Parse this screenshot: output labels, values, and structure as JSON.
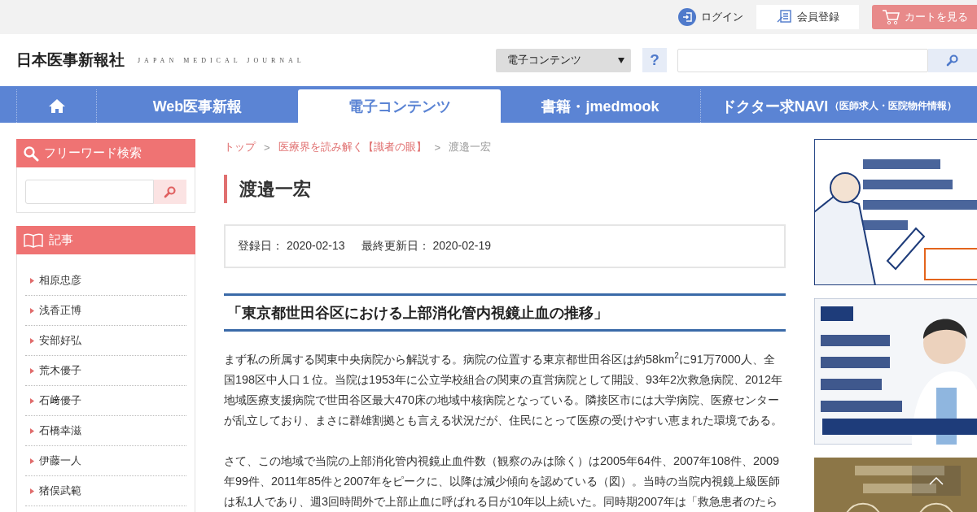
{
  "top_bar": {
    "login": "ログイン",
    "register": "会員登録",
    "cart": "カートを見る"
  },
  "header": {
    "logo": "日本医事新報社",
    "logo_sub": "JAPAN MEDICAL JOURNAL",
    "category_select": "電子コンテンツ",
    "help": "?"
  },
  "nav": [
    {
      "kind": "home",
      "selected": false
    },
    {
      "kind": "text",
      "label": "Web医事新報",
      "selected": false
    },
    {
      "kind": "text",
      "label": "電子コンテンツ",
      "selected": true
    },
    {
      "kind": "text",
      "label": "書籍・jmedmook",
      "selected": false
    },
    {
      "kind": "text",
      "label": "ドクター求NAVI",
      "note": "（医師求人・医院物件情報）",
      "selected": false
    }
  ],
  "sidebar": {
    "search_title": "フリーワード検索",
    "articles_title": "記事",
    "articles": [
      "相原忠彦",
      "浅香正博",
      "安部好弘",
      "荒木優子",
      "石﨑優子",
      "石橋幸滋",
      "伊藤一人",
      "猪俣武範"
    ]
  },
  "breadcrumb": [
    {
      "label": "トップ",
      "link": true
    },
    {
      "separator": ">",
      "label": "医療界を読み解く【識者の眼】",
      "link": true
    },
    {
      "separator": ">",
      "label": "渡邉一宏",
      "link": false
    }
  ],
  "article": {
    "title": "渡邉一宏",
    "registered_label": "登録日：",
    "registered": "2020-02-13",
    "updated_label": "最終更新日：",
    "updated": "2020-02-19",
    "heading": "「東京都世田谷区における上部消化管内視鏡止血の推移」",
    "paragraphs": [
      "まず私の所属する関東中央病院から解説する。病院の位置する東京都世田谷区は約58km$^{2}$に91万7000人、全国198区中人口１位。当院は1953年に公立学校組合の関東の直営病院として開設、93年2次救急病院、2012年地域医療支援病院で世田谷区最大470床の地域中核病院となっている。隣接区市には大学病院、医療センターが乱立しており、まさに群雄割拠とも言える状況だが、住民にとって医療の受けやすい恵まれた環境である。",
      "さて、この地域で当院の上部消化管内視鏡止血件数（観察のみは除く）は2005年64件、2007年108件、2009年99件、2011年85件と2007年をピークに、以降は減少傾向を認めている（図）。当時の当院内視鏡上級医師は私1人であり、週3回時間外で上部止血に呼ばれる日が10年以上続いた。同時期2007年は「救急患者のたら"
    ]
  }
}
